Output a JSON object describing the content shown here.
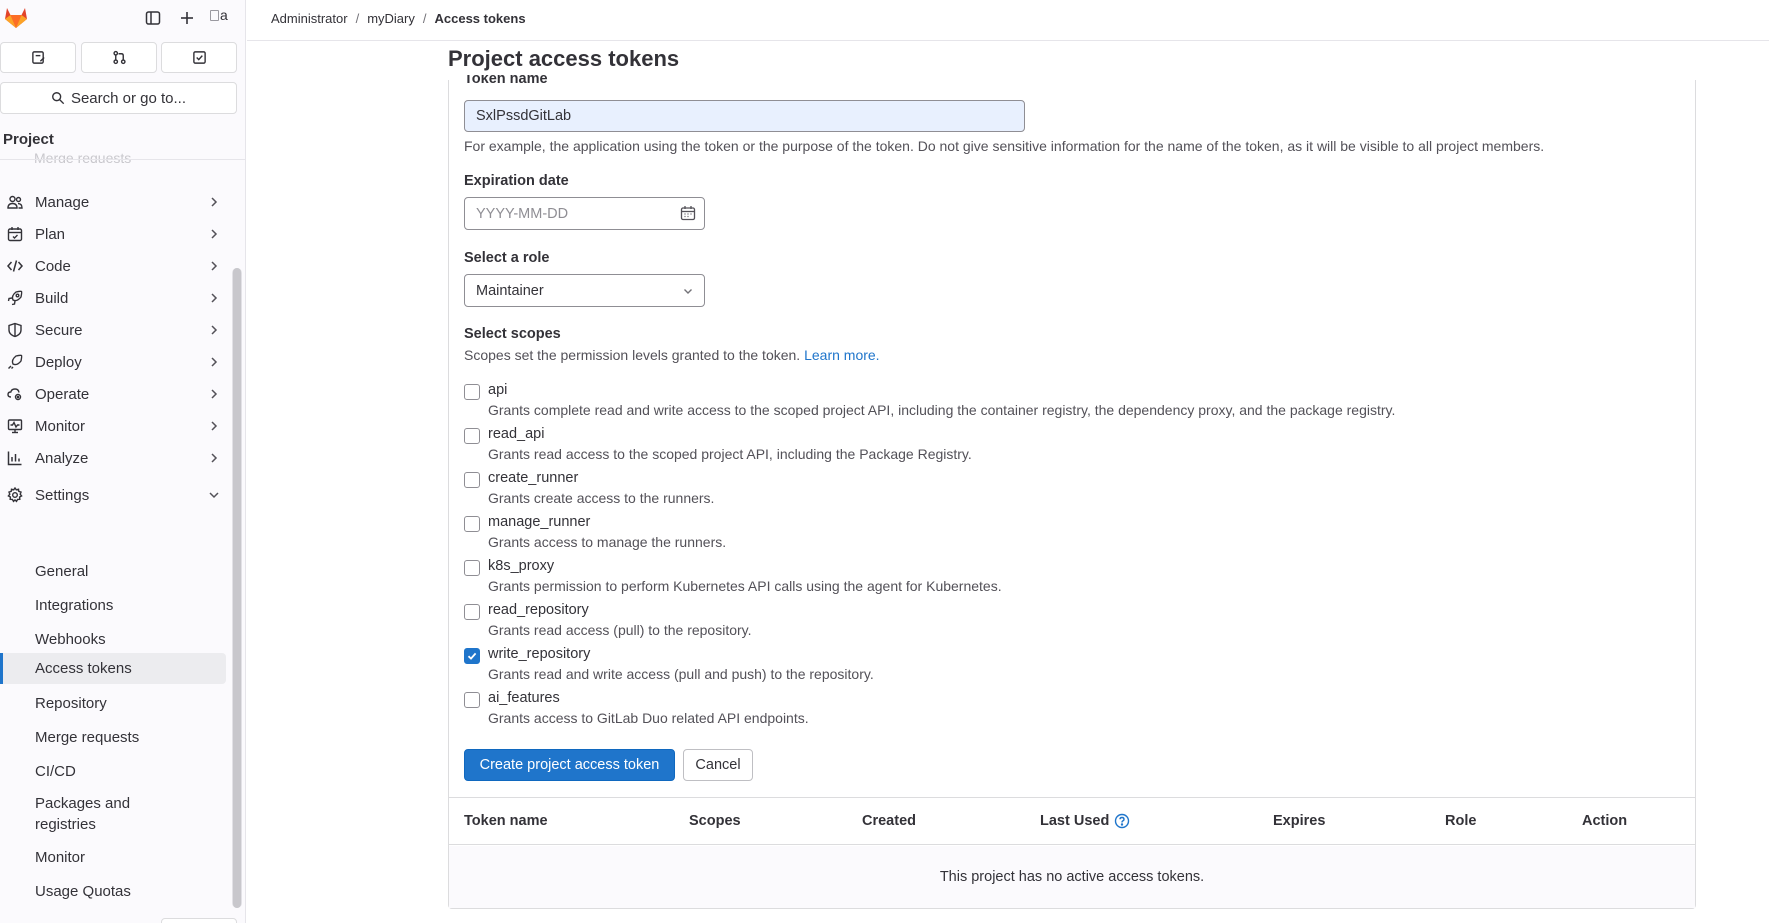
{
  "sidebar": {
    "avatar_alt": "a",
    "search_label": "Search or go to...",
    "section_title": "Project",
    "faded_item": "Merge requests",
    "nav_items": [
      {
        "label": "Manage",
        "icon": "users-icon"
      },
      {
        "label": "Plan",
        "icon": "calendar-icon"
      },
      {
        "label": "Code",
        "icon": "code-icon"
      },
      {
        "label": "Build",
        "icon": "rocket-icon"
      },
      {
        "label": "Secure",
        "icon": "shield-icon"
      },
      {
        "label": "Deploy",
        "icon": "deploy-rocket-icon"
      },
      {
        "label": "Operate",
        "icon": "cloud-gear-icon"
      },
      {
        "label": "Monitor",
        "icon": "monitor-icon"
      },
      {
        "label": "Analyze",
        "icon": "chart-icon"
      },
      {
        "label": "Settings",
        "icon": "gear-icon"
      }
    ],
    "settings_items": [
      "General",
      "Integrations",
      "Webhooks",
      "Access tokens",
      "Repository",
      "Merge requests",
      "CI/CD",
      "Packages and registries",
      "Monitor",
      "Usage Quotas"
    ],
    "active_item": "Access tokens"
  },
  "breadcrumb": {
    "items": [
      "Administrator",
      "myDiary",
      "Access tokens"
    ],
    "separator": "/"
  },
  "page": {
    "title": "Project access tokens"
  },
  "form": {
    "token_name_label": "Token name",
    "token_name_value": "SxlPssdGitLab",
    "token_name_help": "For example, the application using the token or the purpose of the token. Do not give sensitive information for the name of the token, as it will be visible to all project members.",
    "expiration_label": "Expiration date",
    "expiration_placeholder": "YYYY-MM-DD",
    "role_label": "Select a role",
    "role_value": "Maintainer",
    "scopes_label": "Select scopes",
    "scopes_help": "Scopes set the permission levels granted to the token.",
    "scopes_learn_more": "Learn more.",
    "scopes": [
      {
        "name": "api",
        "desc": "Grants complete read and write access to the scoped project API, including the container registry, the dependency proxy, and the package registry.",
        "checked": false
      },
      {
        "name": "read_api",
        "desc": "Grants read access to the scoped project API, including the Package Registry.",
        "checked": false
      },
      {
        "name": "create_runner",
        "desc": "Grants create access to the runners.",
        "checked": false
      },
      {
        "name": "manage_runner",
        "desc": "Grants access to manage the runners.",
        "checked": false
      },
      {
        "name": "k8s_proxy",
        "desc": "Grants permission to perform Kubernetes API calls using the agent for Kubernetes.",
        "checked": false
      },
      {
        "name": "read_repository",
        "desc": "Grants read access (pull) to the repository.",
        "checked": false
      },
      {
        "name": "write_repository",
        "desc": "Grants read and write access (pull and push) to the repository.",
        "checked": true
      },
      {
        "name": "ai_features",
        "desc": "Grants access to GitLab Duo related API endpoints.",
        "checked": false
      }
    ],
    "create_button": "Create project access token",
    "cancel_button": "Cancel"
  },
  "table": {
    "headers": [
      "Token name",
      "Scopes",
      "Created",
      "Last Used",
      "Expires",
      "Role",
      "Action"
    ],
    "empty_message": "This project has no active access tokens."
  },
  "colors": {
    "accent": "#1f75cb",
    "logo_orange": "#e24329"
  }
}
